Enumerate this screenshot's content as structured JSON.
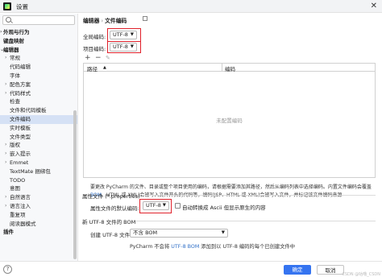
{
  "window": {
    "title": "设置"
  },
  "sidebar": {
    "items": [
      {
        "label": "外观与行为",
        "level": 0,
        "chevron": "›"
      },
      {
        "label": "键盘映射",
        "level": 0,
        "chevron": ""
      },
      {
        "label": "编辑器",
        "level": 0,
        "chevron": "⌄"
      },
      {
        "label": "常规",
        "level": 1,
        "chevron": "›"
      },
      {
        "label": "代码编辑",
        "level": 1,
        "chevron": ""
      },
      {
        "label": "字体",
        "level": 1,
        "chevron": ""
      },
      {
        "label": "配色方案",
        "level": 1,
        "chevron": "›"
      },
      {
        "label": "代码样式",
        "level": 1,
        "chevron": "›"
      },
      {
        "label": "检查",
        "level": 1,
        "chevron": ""
      },
      {
        "label": "文件和代码模板",
        "level": 1,
        "chevron": ""
      },
      {
        "label": "文件编码",
        "level": 1,
        "chevron": "",
        "selected": true
      },
      {
        "label": "实时模板",
        "level": 1,
        "chevron": ""
      },
      {
        "label": "文件类型",
        "level": 1,
        "chevron": ""
      },
      {
        "label": "版权",
        "level": 1,
        "chevron": "›"
      },
      {
        "label": "嵌入提示",
        "level": 1,
        "chevron": "›"
      },
      {
        "label": "Emmet",
        "level": 1,
        "chevron": "›"
      },
      {
        "label": "TextMate 捆绑包",
        "level": 1,
        "chevron": ""
      },
      {
        "label": "TODO",
        "level": 1,
        "chevron": ""
      },
      {
        "label": "意图",
        "level": 1,
        "chevron": ""
      },
      {
        "label": "自然语言",
        "level": 1,
        "chevron": "›"
      },
      {
        "label": "语言注入",
        "level": 1,
        "chevron": "›"
      },
      {
        "label": "重复项",
        "level": 1,
        "chevron": ""
      },
      {
        "label": "阅读器模式",
        "level": 1,
        "chevron": ""
      },
      {
        "label": "插件",
        "level": 0,
        "chevron": ""
      }
    ]
  },
  "breadcrumb": {
    "parent": "编辑器",
    "separator": "›",
    "current": "文件编码"
  },
  "global_encoding": {
    "label": "全局编码:",
    "value": "UTF-8"
  },
  "project_encoding": {
    "label": "项目编码:",
    "value": "UTF-8"
  },
  "toolbar": {
    "add": "+",
    "remove": "−",
    "edit": "✎"
  },
  "table": {
    "col_path": "路径",
    "sort_arrow": "▲",
    "col_encoding": "编码",
    "empty": "未配置编码"
  },
  "description": {
    "part1": "要更改 PyCharm 的文件、目录或整个项目使用的编码，请根据需要添加其路径，然后从编码列表中选择编码。内置文件编码会覆盖",
    "link": "BOM",
    "part2": "、HTML 或 XML)会被写入文件开头的代码等。编码(JSP、HTML 或 XML)会被写入文件，并标记该文件编码来源"
  },
  "properties": {
    "section_title": "属性文件 (*.properties)",
    "default_label": "属性文件的默认编码:",
    "default_value": "UTF-8",
    "ascii_checkbox": "自动转换成 Ascii 但显示原生的内容"
  },
  "bom": {
    "section_title": "新 UTF-8 文件的 BOM",
    "create_label": "创建 UTF-8 文件:",
    "create_value": "不含 BOM",
    "note_part1": "PyCharm 不会将",
    "note_link": "UTF-8 BOM",
    "note_part2": "添加到以 UTF-8 编码的每个已创建文件中"
  },
  "footer": {
    "ok": "确定",
    "cancel": "取消",
    "help": "?"
  },
  "watermark": "CSDN @咕噜_CSDN",
  "colors": {
    "accent": "#3574f0",
    "highlight": "#e0212b",
    "selected": "#d5e1f5",
    "link": "#2f6fc7"
  }
}
